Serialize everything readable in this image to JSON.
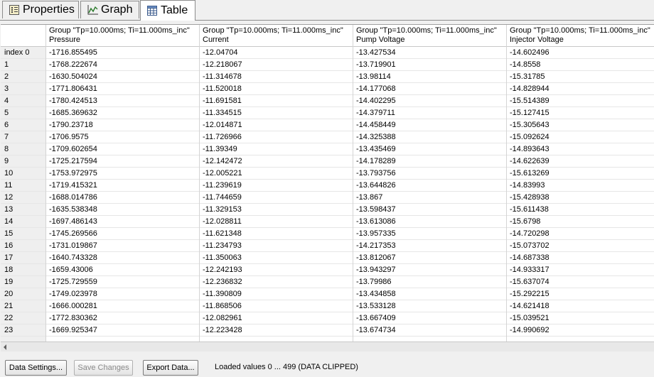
{
  "tabs": [
    {
      "label": "Properties",
      "icon": "properties-icon"
    },
    {
      "label": "Graph",
      "icon": "graph-icon"
    },
    {
      "label": "Table",
      "icon": "table-icon"
    }
  ],
  "table": {
    "columns": [
      {
        "group": "Group \"Tp=10.000ms; Ti=11.000ms_inc\"",
        "name": "Pressure"
      },
      {
        "group": "Group \"Tp=10.000ms; Ti=11.000ms_inc\"",
        "name": "Current"
      },
      {
        "group": "Group \"Tp=10.000ms; Ti=11.000ms_inc\"",
        "name": "Pump Voltage"
      },
      {
        "group": "Group \"Tp=10.000ms; Ti=11.000ms_inc\"",
        "name": "Injector Voltage"
      }
    ],
    "rows": [
      {
        "index": "index 0",
        "values": [
          "-1716.855495",
          "-12.04704",
          "-13.427534",
          "-14.602496"
        ]
      },
      {
        "index": "1",
        "values": [
          "-1768.222674",
          "-12.218067",
          "-13.719901",
          "-14.8558"
        ]
      },
      {
        "index": "2",
        "values": [
          "-1630.504024",
          "-11.314678",
          "-13.98114",
          "-15.31785"
        ]
      },
      {
        "index": "3",
        "values": [
          "-1771.806431",
          "-11.520018",
          "-14.177068",
          "-14.828944"
        ]
      },
      {
        "index": "4",
        "values": [
          "-1780.424513",
          "-11.691581",
          "-14.402295",
          "-15.514389"
        ]
      },
      {
        "index": "5",
        "values": [
          "-1685.369632",
          "-11.334515",
          "-14.379711",
          "-15.127415"
        ]
      },
      {
        "index": "6",
        "values": [
          "-1790.23718",
          "-12.014871",
          "-14.458449",
          "-15.305643"
        ]
      },
      {
        "index": "7",
        "values": [
          "-1706.9575",
          "-11.726966",
          "-14.325388",
          "-15.092624"
        ]
      },
      {
        "index": "8",
        "values": [
          "-1709.602654",
          "-11.39349",
          "-13.435469",
          "-14.893643"
        ]
      },
      {
        "index": "9",
        "values": [
          "-1725.217594",
          "-12.142472",
          "-14.178289",
          "-14.622639"
        ]
      },
      {
        "index": "10",
        "values": [
          "-1753.972975",
          "-12.005221",
          "-13.793756",
          "-15.613269"
        ]
      },
      {
        "index": "11",
        "values": [
          "-1719.415321",
          "-11.239619",
          "-13.644826",
          "-14.83993"
        ]
      },
      {
        "index": "12",
        "values": [
          "-1688.014786",
          "-11.744659",
          "-13.867",
          "-15.428938"
        ]
      },
      {
        "index": "13",
        "values": [
          "-1635.538348",
          "-11.329153",
          "-13.598437",
          "-15.611438"
        ]
      },
      {
        "index": "14",
        "values": [
          "-1697.486143",
          "-12.028811",
          "-13.613086",
          "-15.6798"
        ]
      },
      {
        "index": "15",
        "values": [
          "-1745.269566",
          "-11.621348",
          "-13.957335",
          "-14.720298"
        ]
      },
      {
        "index": "16",
        "values": [
          "-1731.019867",
          "-11.234793",
          "-14.217353",
          "-15.073702"
        ]
      },
      {
        "index": "17",
        "values": [
          "-1640.743328",
          "-11.350063",
          "-13.812067",
          "-14.687338"
        ]
      },
      {
        "index": "18",
        "values": [
          "-1659.43006",
          "-12.242193",
          "-13.943297",
          "-14.933317"
        ]
      },
      {
        "index": "19",
        "values": [
          "-1725.729559",
          "-12.236832",
          "-13.79986",
          "-15.637074"
        ]
      },
      {
        "index": "20",
        "values": [
          "-1749.023978",
          "-11.390809",
          "-13.434858",
          "-15.292215"
        ]
      },
      {
        "index": "21",
        "values": [
          "-1666.000281",
          "-11.868506",
          "-13.533128",
          "-14.621418"
        ]
      },
      {
        "index": "22",
        "values": [
          "-1772.830362",
          "-12.082961",
          "-13.667409",
          "-15.039521"
        ]
      },
      {
        "index": "23",
        "values": [
          "-1669.925347",
          "-12.223428",
          "-13.674734",
          "-14.990692"
        ]
      }
    ]
  },
  "footer": {
    "data_settings_label": "Data Settings...",
    "save_changes_label": "Save Changes",
    "export_data_label": "Export Data...",
    "status": "Loaded values 0 ... 499 (DATA CLIPPED)"
  }
}
